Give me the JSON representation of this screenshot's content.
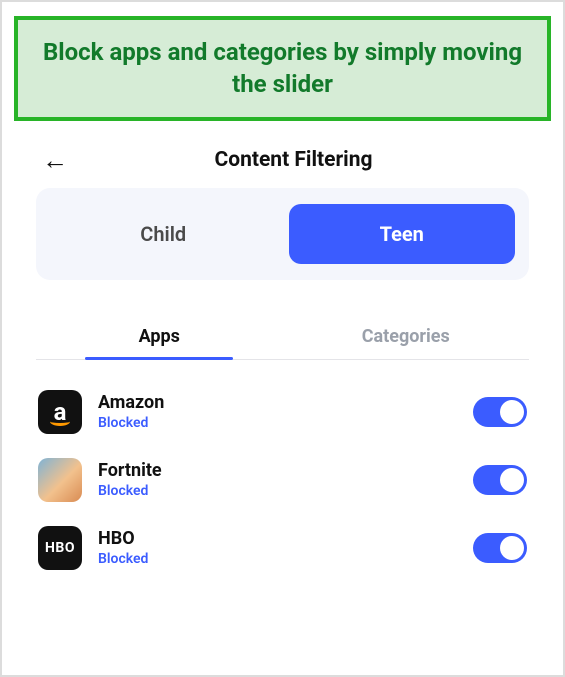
{
  "callout": "Block apps and categories by simply moving the slider",
  "header": {
    "title": "Content Filtering"
  },
  "segments": {
    "child": "Child",
    "teen": "Teen",
    "active": "teen"
  },
  "tabs": {
    "apps": "Apps",
    "categories": "Categories",
    "active": "apps"
  },
  "apps": [
    {
      "name": "Amazon",
      "status": "Blocked",
      "icon": "amazon",
      "blocked": true
    },
    {
      "name": "Fortnite",
      "status": "Blocked",
      "icon": "fortnite",
      "blocked": true
    },
    {
      "name": "HBO",
      "status": "Blocked",
      "icon": "hbo",
      "blocked": true
    }
  ],
  "colors": {
    "accent": "#3b5cff",
    "callout_border": "#28b428",
    "callout_bg": "#d6ecd6"
  }
}
